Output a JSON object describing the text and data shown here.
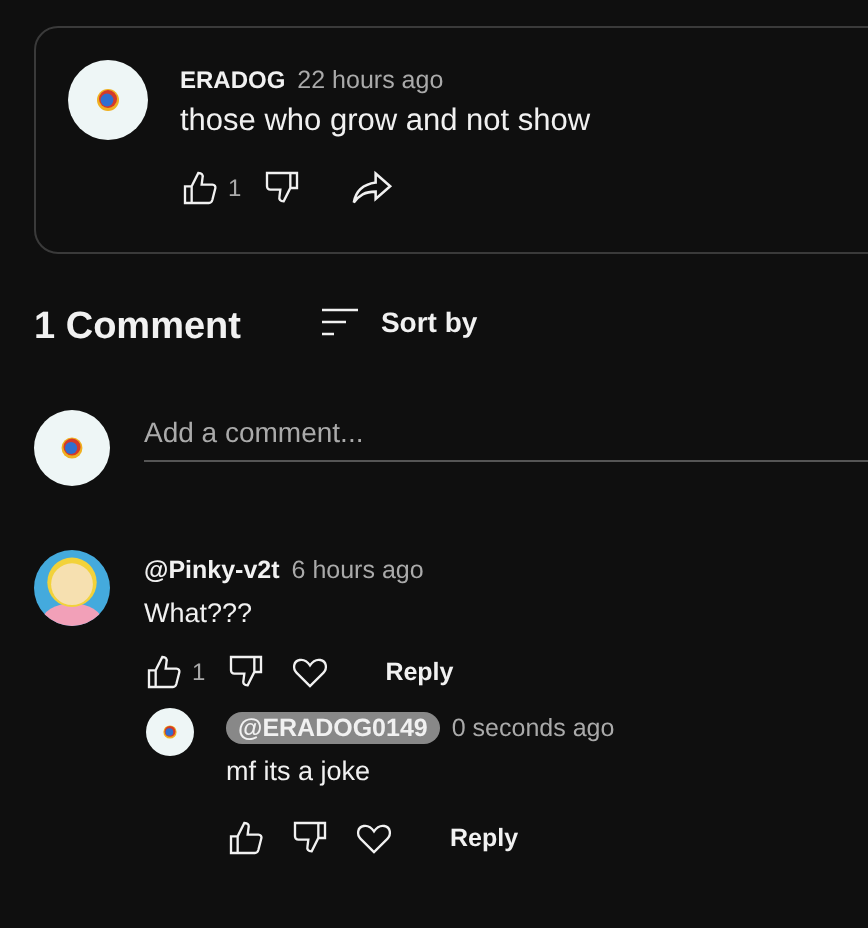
{
  "pinned_comment": {
    "author": "ERADOG",
    "time": "22 hours ago",
    "text": "those who grow and not show",
    "likes": "1"
  },
  "comments_header": {
    "count": "1 Comment",
    "sort_label": "Sort by"
  },
  "add_comment": {
    "placeholder": "Add a comment..."
  },
  "comments": [
    {
      "author": "@Pinky-v2t",
      "highlighted": false,
      "time": "6 hours ago",
      "text": "What???",
      "likes": "1",
      "reply_label": "Reply",
      "replies": [
        {
          "author": "@ERADOG0149",
          "highlighted": true,
          "time": "0 seconds ago",
          "text": "mf its a joke",
          "reply_label": "Reply"
        }
      ]
    }
  ]
}
